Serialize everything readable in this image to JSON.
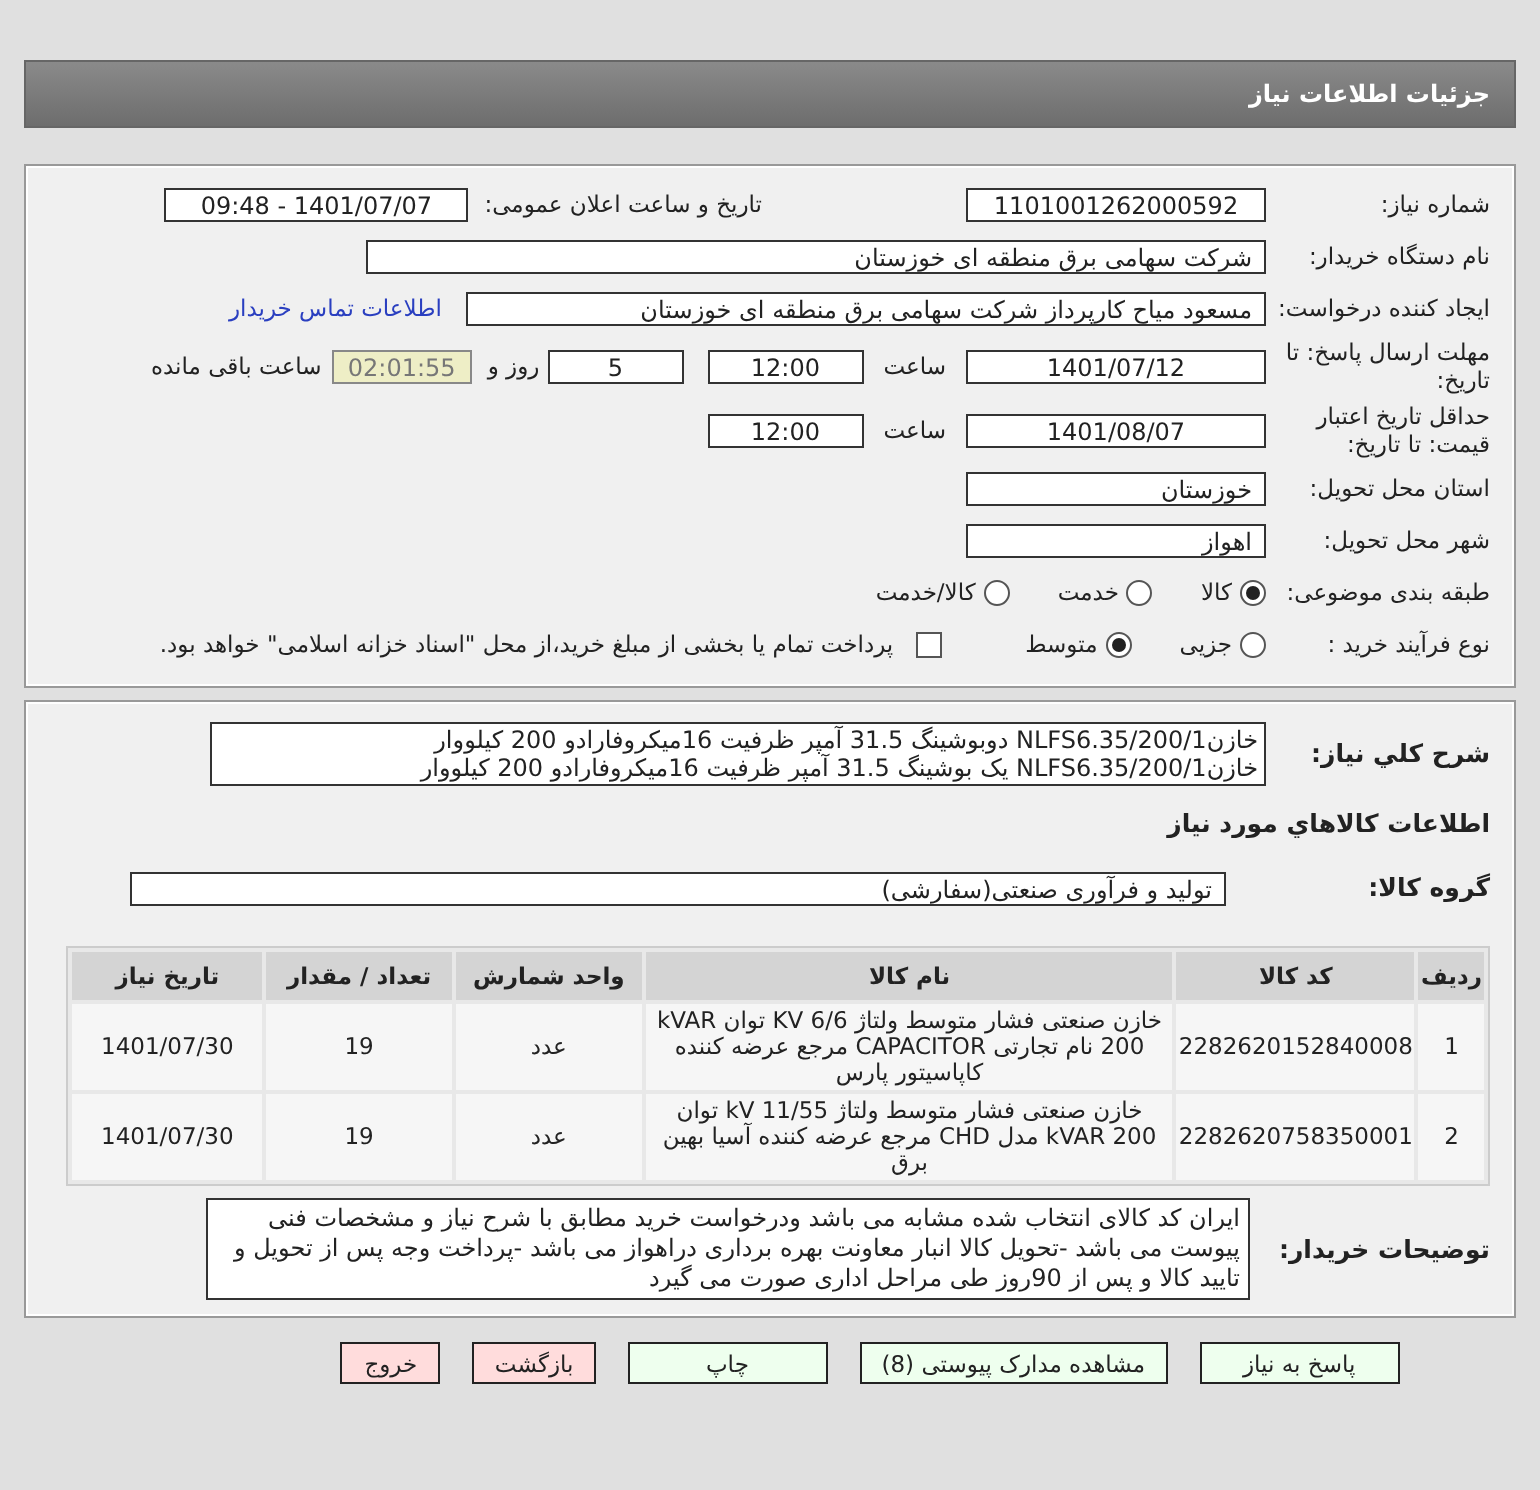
{
  "header": {
    "title": "جزئیات اطلاعات نیاز"
  },
  "need_info": {
    "need_number": {
      "label": "شماره نیاز:",
      "value": "1101001262000592"
    },
    "announce": {
      "label": "تاریخ و ساعت اعلان عمومی:",
      "value": "1401/07/07 - 09:48"
    },
    "buyer": {
      "label": "نام دستگاه خریدار:",
      "value": "شرکت سهامی برق منطقه ای خوزستان"
    },
    "requester": {
      "label": "ایجاد کننده درخواست:",
      "value": "مسعود میاح کارپرداز شرکت سهامی برق منطقه ای خوزستان",
      "link": "اطلاعات تماس خریدار"
    },
    "deadline": {
      "label": "مهلت ارسال پاسخ: تا تاریخ:",
      "date": "1401/07/12",
      "time_label": "ساعت",
      "time": "12:00",
      "days": "5",
      "days_label": "روز و",
      "remaining": "02:01:55",
      "remaining_label": "ساعت باقی مانده"
    },
    "validity": {
      "label": "حداقل تاریخ اعتبار قیمت: تا تاریخ:",
      "date": "1401/08/07",
      "time_label": "ساعت",
      "time": "12:00"
    },
    "province": {
      "label": "استان محل تحویل:",
      "value": "خوزستان"
    },
    "city": {
      "label": "شهر محل تحویل:",
      "value": "اهواز"
    },
    "category": {
      "label": "طبقه بندی موضوعی:",
      "options": [
        {
          "label": "کالا",
          "selected": true
        },
        {
          "label": "خدمت",
          "selected": false
        },
        {
          "label": "کالا/خدمت",
          "selected": false
        }
      ]
    },
    "purchase_type": {
      "label": "نوع فرآیند خرید :",
      "options": [
        {
          "label": "جزیی",
          "selected": false
        },
        {
          "label": "متوسط",
          "selected": true
        }
      ],
      "payment": {
        "label": "پرداخت تمام یا بخشی از مبلغ خرید،از محل \"اسناد خزانه اسلامی\" خواهد بود.",
        "checked": false
      }
    }
  },
  "details": {
    "description": {
      "label": "شرح کلي نياز:",
      "lines": [
        "خازن1/NLFS6.35/200 دوبوشینگ 31.5 آمپر ظرفیت 16میکروفارادو 200 کیلووار",
        "خازن1/NLFS6.35/200 یک بوشینگ 31.5 آمپر ظرفیت 16میکروفارادو 200 کیلووار"
      ]
    },
    "goods_heading": "اطلاعات کالاهاي مورد نياز",
    "group": {
      "label": "گروه کالا:",
      "value": "تولید و فرآوری صنعتی(سفارشی)"
    },
    "table": {
      "columns": [
        "ردیف",
        "کد کالا",
        "نام کالا",
        "واحد شمارش",
        "تعداد / مقدار",
        "تاریخ نیاز"
      ],
      "rows": [
        [
          "1",
          "2282620152840008",
          "خازن صنعتی فشار متوسط ولتاژ KV 6/6 توان kVAR 200 نام تجارتی CAPACITOR مرجع عرضه کننده کاپاسیتور پارس",
          "عدد",
          "19",
          "1401/07/30"
        ],
        [
          "2",
          "2282620758350001",
          "خازن صنعتی فشار متوسط ولتاژ kV 11/55 توان kVAR 200 مدل CHD مرجع عرضه کننده آسیا بهین برق",
          "عدد",
          "19",
          "1401/07/30"
        ]
      ]
    },
    "notes": {
      "label": "توضیحات خریدار:",
      "text": "ایران کد کالای انتخاب شده مشابه می باشد ودرخواست خرید مطابق با شرح نیاز و مشخصات فنی پیوست می باشد -تحویل کالا انبار معاونت بهره برداری دراهواز می باشد -پرداخت وجه پس از تحویل و تایید کالا و پس از 90روز طی مراحل اداری صورت می گیرد"
    }
  },
  "buttons": [
    {
      "label": "پاسخ به نیاز",
      "kind": "green"
    },
    {
      "label": "مشاهده مدارک پیوستی (8)",
      "kind": "green"
    },
    {
      "label": "چاپ",
      "kind": "green"
    },
    {
      "label": "بازگشت",
      "kind": "red"
    },
    {
      "label": "خروج",
      "kind": "red"
    }
  ]
}
